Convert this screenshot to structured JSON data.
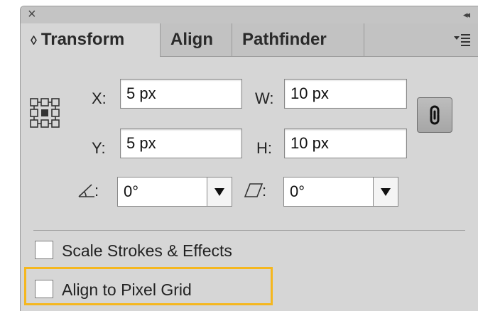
{
  "titlebar": {
    "close": "×",
    "collapse": "◂◂"
  },
  "tabs": [
    {
      "label": "Transform",
      "prefix": "◊",
      "active": true
    },
    {
      "label": "Align",
      "active": false
    },
    {
      "label": "Pathfinder",
      "active": false
    }
  ],
  "fields": {
    "x": {
      "label": "X:",
      "value": "5 px"
    },
    "y": {
      "label": "Y:",
      "value": "5 px"
    },
    "w": {
      "label": "W:",
      "value": "10 px"
    },
    "h": {
      "label": "H:",
      "value": "10 px"
    }
  },
  "rotate": {
    "label": ":",
    "value": "0°"
  },
  "shear": {
    "label": ":",
    "value": "0°"
  },
  "checkboxes": [
    {
      "label": "Scale Strokes & Effects",
      "checked": false
    },
    {
      "label": "Align to Pixel Grid",
      "checked": false,
      "highlighted": true
    }
  ],
  "colors": {
    "highlight": "#f5b71e",
    "panel": "#d6d6d6"
  },
  "icons": [
    "close-icon",
    "collapse-icon",
    "panel-menu-icon",
    "reference-point-icon",
    "constrain-proportions-link-icon",
    "rotate-angle-icon",
    "shear-angle-icon"
  ]
}
